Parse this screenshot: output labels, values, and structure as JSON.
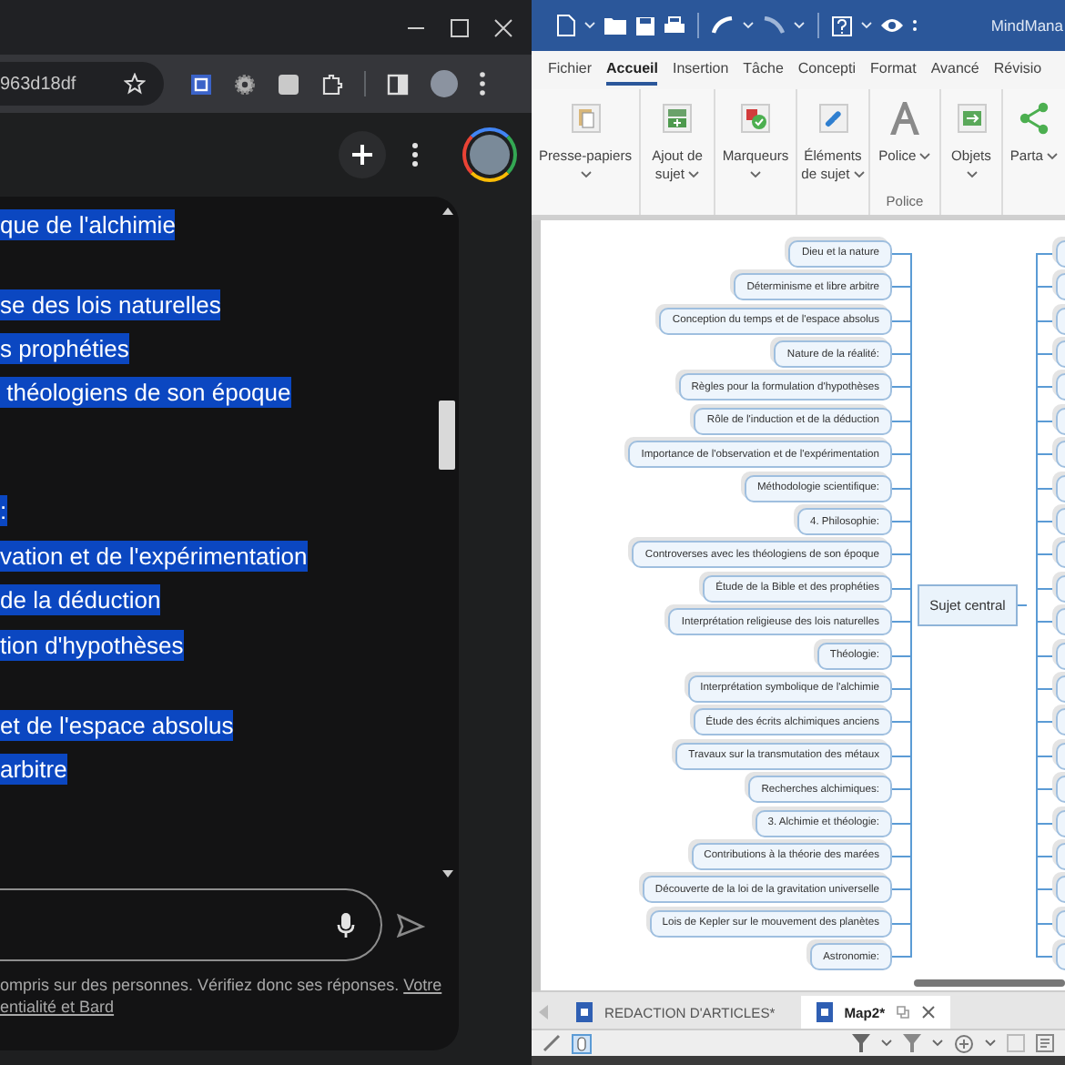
{
  "browser": {
    "address_bar": {
      "value": "963d18df"
    },
    "chat": {
      "blocks": [
        {
          "lines": [
            {
              "text": "que de l'alchimie",
              "highlighted": true
            }
          ]
        },
        {
          "lines": [
            {
              "text": "se des lois naturelles",
              "highlighted": true
            },
            {
              "text": "s prophéties",
              "highlighted": true
            },
            {
              "text": " théologiens de son époque",
              "highlighted": true
            }
          ]
        },
        {
          "lines": [
            {
              "text": ":",
              "highlighted": true
            },
            {
              "text": "vation et de l'expérimentation",
              "highlighted": true
            },
            {
              "text": "de la déduction",
              "highlighted": true
            },
            {
              "text": "tion d'hypothèses",
              "highlighted": true
            }
          ]
        },
        {
          "lines": [
            {
              "text": "et de l'espace absolus",
              "highlighted": true
            },
            {
              "text": "arbitre",
              "highlighted": true
            }
          ]
        }
      ]
    },
    "footer": {
      "text": "ompris sur des personnes. Vérifiez donc ses réponses.",
      "link": "Votre",
      "link_continued": "entialité et Bard"
    }
  },
  "mindmanager": {
    "title": "MindMana",
    "ribbon_tabs": [
      {
        "label": "Fichier",
        "selected": false
      },
      {
        "label": "Accueil",
        "selected": true
      },
      {
        "label": "Insertion",
        "selected": false
      },
      {
        "label": "Tâche",
        "selected": false
      },
      {
        "label": "Concepti",
        "selected": false
      },
      {
        "label": "Format",
        "selected": false
      },
      {
        "label": "Avancé",
        "selected": false
      },
      {
        "label": "Révisio",
        "selected": false
      }
    ],
    "ribbon_groups": [
      {
        "label": "Presse-papiers",
        "kind": "clipboard"
      },
      {
        "label": "Ajout de sujet",
        "kind": "add-topic"
      },
      {
        "label": "Marqueurs",
        "kind": "markers"
      },
      {
        "label": "Éléments de sujet",
        "kind": "topic-elements"
      },
      {
        "label": "Police",
        "kind": "font",
        "caption": "Police"
      },
      {
        "label": "Objets",
        "kind": "objects"
      },
      {
        "label": "Parta",
        "kind": "share"
      }
    ],
    "map": {
      "central_topic": "Sujet central",
      "left_topics": [
        "Dieu et la nature",
        "Déterminisme et libre arbitre",
        "Conception du temps et de l'espace absolus",
        "Nature de la réalité:",
        "Règles pour la formulation d'hypothèses",
        "Rôle de l'induction et de la déduction",
        "Importance de l'observation et de l'expérimentation",
        "Méthodologie scientifique:",
        "4. Philosophie:",
        "Controverses avec les théologiens de son époque",
        "Étude de la Bible et des prophéties",
        "Interprétation religieuse des lois naturelles",
        "Théologie:",
        "Interprétation symbolique de l'alchimie",
        "Étude des écrits alchimiques anciens",
        "Travaux sur la transmutation des métaux",
        "Recherches alchimiques:",
        "3. Alchimie et théologie:",
        "Contributions à la théorie des marées",
        "Découverte de la loi de la gravitation universelle",
        "Lois de Kepler sur le mouvement des planètes",
        "Astronomie:"
      ]
    },
    "doc_tabs": [
      {
        "label": "REDACTION D'ARTICLES*",
        "selected": false
      },
      {
        "label": "Map2*",
        "selected": true
      }
    ]
  }
}
